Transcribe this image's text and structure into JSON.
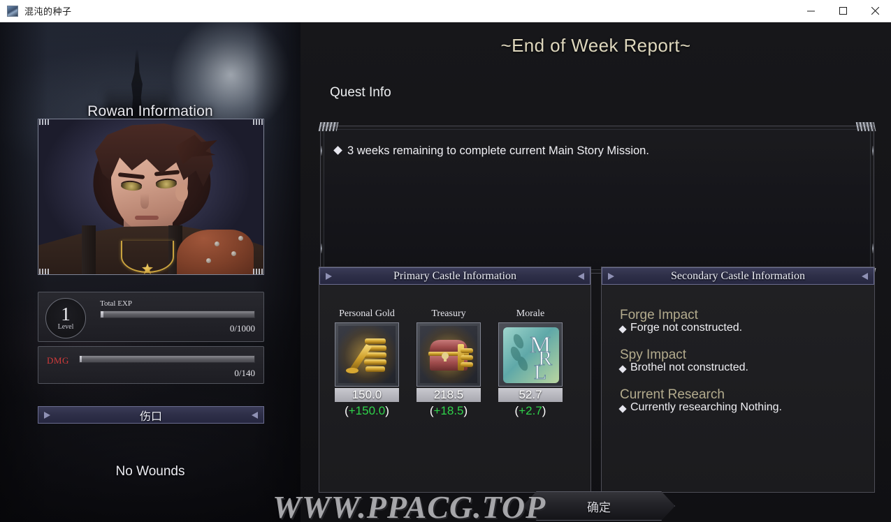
{
  "window": {
    "title": "混沌的种子",
    "app_icon": "game-icon",
    "controls": [
      {
        "name": "minimize-button",
        "glyph": "minimize-icon"
      },
      {
        "name": "maximize-button",
        "glyph": "maximize-icon"
      },
      {
        "name": "close-button",
        "glyph": "close-icon"
      }
    ]
  },
  "left": {
    "character_title": "Rowan Information",
    "portrait_name": "rowan-portrait",
    "level": {
      "value": "1",
      "label": "Level"
    },
    "exp": {
      "label": "Total EXP",
      "value": "0/1000",
      "percent": 0
    },
    "dmg": {
      "label": "DMG",
      "value": "0/140",
      "percent": 0
    },
    "wounds": {
      "header": "伤口",
      "empty_text": "No Wounds"
    }
  },
  "right": {
    "report_title": "~End of Week Report~",
    "quest": {
      "label": "Quest Info",
      "items": [
        "3 weeks remaining to complete current Main Story Mission."
      ]
    },
    "primary_castle": {
      "header": "Primary Castle Information",
      "resources": [
        {
          "name": "Personal Gold",
          "icon": "gold-coins-icon",
          "value": "150.0",
          "delta": "(+150.0)",
          "delta_sign": "+",
          "delta_number": "150.0"
        },
        {
          "name": "Treasury",
          "icon": "treasure-chest-icon",
          "value": "218.5",
          "delta": "(+18.5)",
          "delta_sign": "+",
          "delta_number": "18.5"
        },
        {
          "name": "Morale",
          "icon": "morale-mrl-icon",
          "value": "52.7",
          "delta": "(+2.7)",
          "delta_sign": "+",
          "delta_number": "2.7"
        }
      ]
    },
    "secondary_castle": {
      "header": "Secondary Castle Information",
      "blocks": [
        {
          "heading": "Forge Impact",
          "item": "Forge not constructed."
        },
        {
          "heading": "Spy Impact",
          "item": "Brothel not constructed."
        },
        {
          "heading": "Current Research",
          "item": "Currently researching Nothing."
        }
      ]
    },
    "confirm_button": "确定"
  },
  "overlay": {
    "watermark": "WWW.PPACG.TOP"
  },
  "colors": {
    "accent_gold": "#ded7bd",
    "header_purple": "#2e2f48",
    "positive_green": "#2fd44a",
    "dmg_red": "#d23b3b",
    "sec_heading": "#b3ab8d"
  }
}
